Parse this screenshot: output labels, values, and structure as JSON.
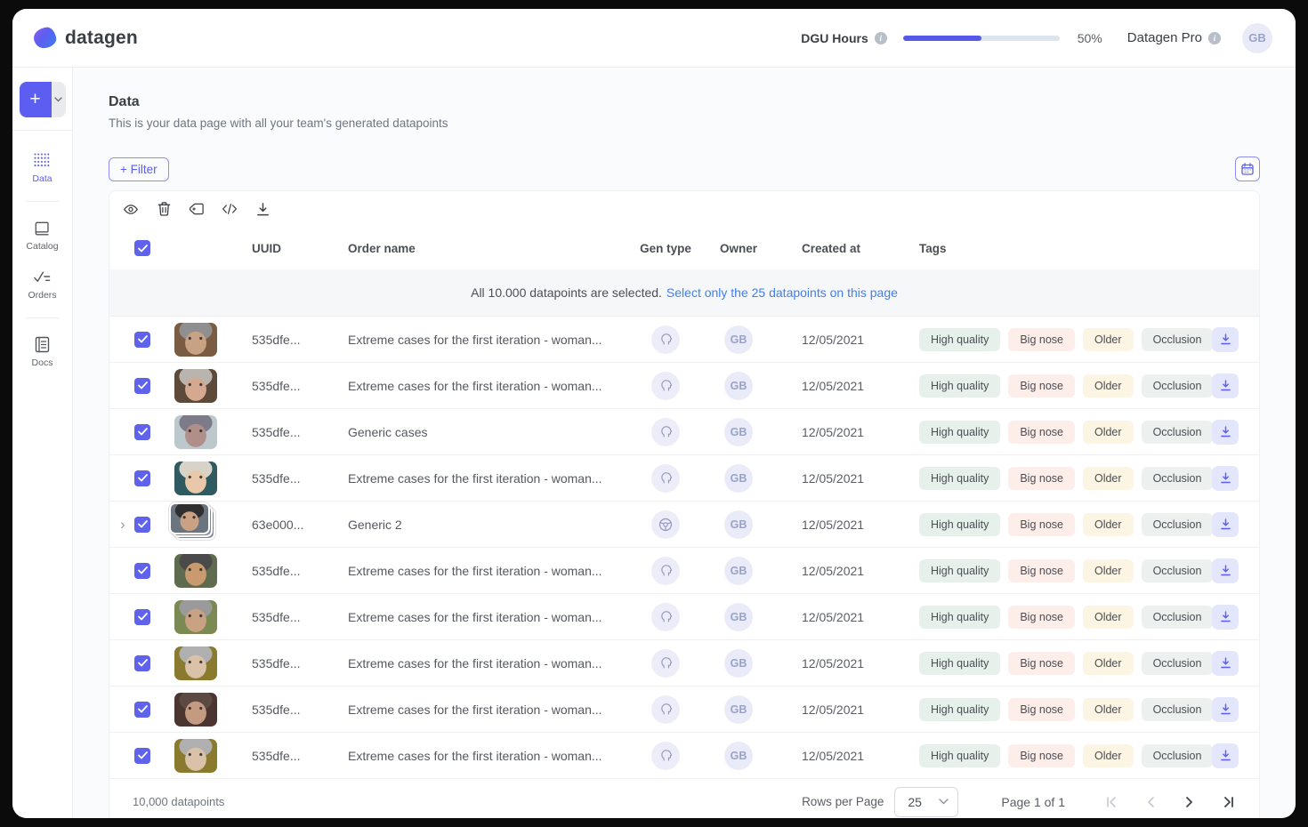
{
  "brand": {
    "name": "datagen"
  },
  "header": {
    "dgu_label": "DGU Hours",
    "progress_pct": 50,
    "progress_text": "50%",
    "plan_label": "Datagen Pro",
    "avatar_initials": "GB"
  },
  "sidebar": {
    "new_button": {
      "plus": "+"
    },
    "items": [
      {
        "id": "data",
        "label": "Data",
        "active": true
      },
      {
        "id": "catalog",
        "label": "Catalog",
        "active": false
      },
      {
        "id": "orders",
        "label": "Orders",
        "active": false
      },
      {
        "id": "docs",
        "label": "Docs",
        "active": false
      }
    ]
  },
  "page": {
    "title": "Data",
    "subtitle": "This is your data page with all your team's generated datapoints",
    "filter_label": "+ Filter"
  },
  "table": {
    "columns": {
      "uuid": "UUID",
      "order": "Order name",
      "gen": "Gen type",
      "owner": "Owner",
      "created": "Created at",
      "tags": "Tags"
    },
    "banner": {
      "text": "All 10.000 datapoints are selected.",
      "link": "Select only the 25 datapoints on this page"
    },
    "tag_styles": {
      "High quality": "#e7f1ec",
      "Big nose": "#fdeeea",
      "Older": "#fdf5e4",
      "Occlusion": "#ecf1ef"
    },
    "rows": [
      {
        "uuid": "535dfe...",
        "order": "Extreme cases for the first iteration - woman...",
        "gen": "face",
        "owner": "GB",
        "created": "12/05/2021",
        "tags": [
          "High quality",
          "Big nose",
          "Older",
          "Occlusion"
        ],
        "stacked": false,
        "thumb": {
          "bg": "#7a5c42",
          "hair": "#8f8f8f",
          "skin": "#c9a183"
        }
      },
      {
        "uuid": "535dfe...",
        "order": "Extreme cases for the first iteration - woman...",
        "gen": "face",
        "owner": "GB",
        "created": "12/05/2021",
        "tags": [
          "High quality",
          "Big nose",
          "Older",
          "Occlusion"
        ],
        "stacked": false,
        "thumb": {
          "bg": "#5d4a3a",
          "hair": "#b9b4ae",
          "skin": "#d4a98f"
        }
      },
      {
        "uuid": "535dfe...",
        "order": "Generic cases",
        "gen": "face",
        "owner": "GB",
        "created": "12/05/2021",
        "tags": [
          "High quality",
          "Big nose",
          "Older",
          "Occlusion"
        ],
        "stacked": false,
        "thumb": {
          "bg": "#bcc8cc",
          "hair": "#7d7a8a",
          "skin": "#b08f8a"
        }
      },
      {
        "uuid": "535dfe...",
        "order": "Extreme cases for the first iteration - woman...",
        "gen": "face",
        "owner": "GB",
        "created": "12/05/2021",
        "tags": [
          "High quality",
          "Big nose",
          "Older",
          "Occlusion"
        ],
        "stacked": false,
        "thumb": {
          "bg": "#2e5a60",
          "hair": "#d8d3c8",
          "skin": "#e8c8a8"
        }
      },
      {
        "uuid": "63e000...",
        "order": "Generic 2",
        "gen": "wheel",
        "owner": "GB",
        "created": "12/05/2021",
        "tags": [
          "High quality",
          "Big nose",
          "Older",
          "Occlusion"
        ],
        "stacked": true,
        "thumb": {
          "bg": "#6a7580",
          "hair": "#2f2f2f",
          "skin": "#caa183"
        }
      },
      {
        "uuid": "535dfe...",
        "order": "Extreme cases for the first iteration - woman...",
        "gen": "face",
        "owner": "GB",
        "created": "12/05/2021",
        "tags": [
          "High quality",
          "Big nose",
          "Older",
          "Occlusion"
        ],
        "stacked": false,
        "thumb": {
          "bg": "#5f6b4e",
          "hair": "#4a4a4a",
          "skin": "#c89a6e"
        }
      },
      {
        "uuid": "535dfe...",
        "order": "Extreme cases for the first iteration - woman...",
        "gen": "face",
        "owner": "GB",
        "created": "12/05/2021",
        "tags": [
          "High quality",
          "Big nose",
          "Older",
          "Occlusion"
        ],
        "stacked": false,
        "thumb": {
          "bg": "#7a8a52",
          "hair": "#9a9a9a",
          "skin": "#c9a183"
        }
      },
      {
        "uuid": "535dfe...",
        "order": "Extreme cases for the first iteration - woman...",
        "gen": "face",
        "owner": "GB",
        "created": "12/05/2021",
        "tags": [
          "High quality",
          "Big nose",
          "Older",
          "Occlusion"
        ],
        "stacked": false,
        "thumb": {
          "bg": "#8a7a2e",
          "hair": "#b0b0b0",
          "skin": "#d9c2a8"
        }
      },
      {
        "uuid": "535dfe...",
        "order": "Extreme cases for the first iteration - woman...",
        "gen": "face",
        "owner": "GB",
        "created": "12/05/2021",
        "tags": [
          "High quality",
          "Big nose",
          "Older",
          "Occlusion"
        ],
        "stacked": false,
        "thumb": {
          "bg": "#4a3530",
          "hair": "#5a4a42",
          "skin": "#c49a80"
        }
      },
      {
        "uuid": "535dfe...",
        "order": "Extreme cases for the first iteration - woman...",
        "gen": "face",
        "owner": "GB",
        "created": "12/05/2021",
        "tags": [
          "High quality",
          "Big nose",
          "Older",
          "Occlusion"
        ],
        "stacked": false,
        "thumb": {
          "bg": "#8a7a2e",
          "hair": "#b0b0b0",
          "skin": "#d9c2a8"
        }
      }
    ],
    "footer": {
      "count_text": "10,000 datapoints",
      "rows_per_page_label": "Rows per Page",
      "rows_per_page_value": "25",
      "page_label": "Page 1  of  1"
    }
  },
  "colors": {
    "accent": "#5b5ef0",
    "progress_fill": "#5558e8",
    "link": "#4080ee",
    "tag_high_quality": "#e7f1ec",
    "tag_big_nose": "#fdeeea",
    "tag_older": "#fdf5e4",
    "tag_occlusion": "#ecf1ef"
  }
}
